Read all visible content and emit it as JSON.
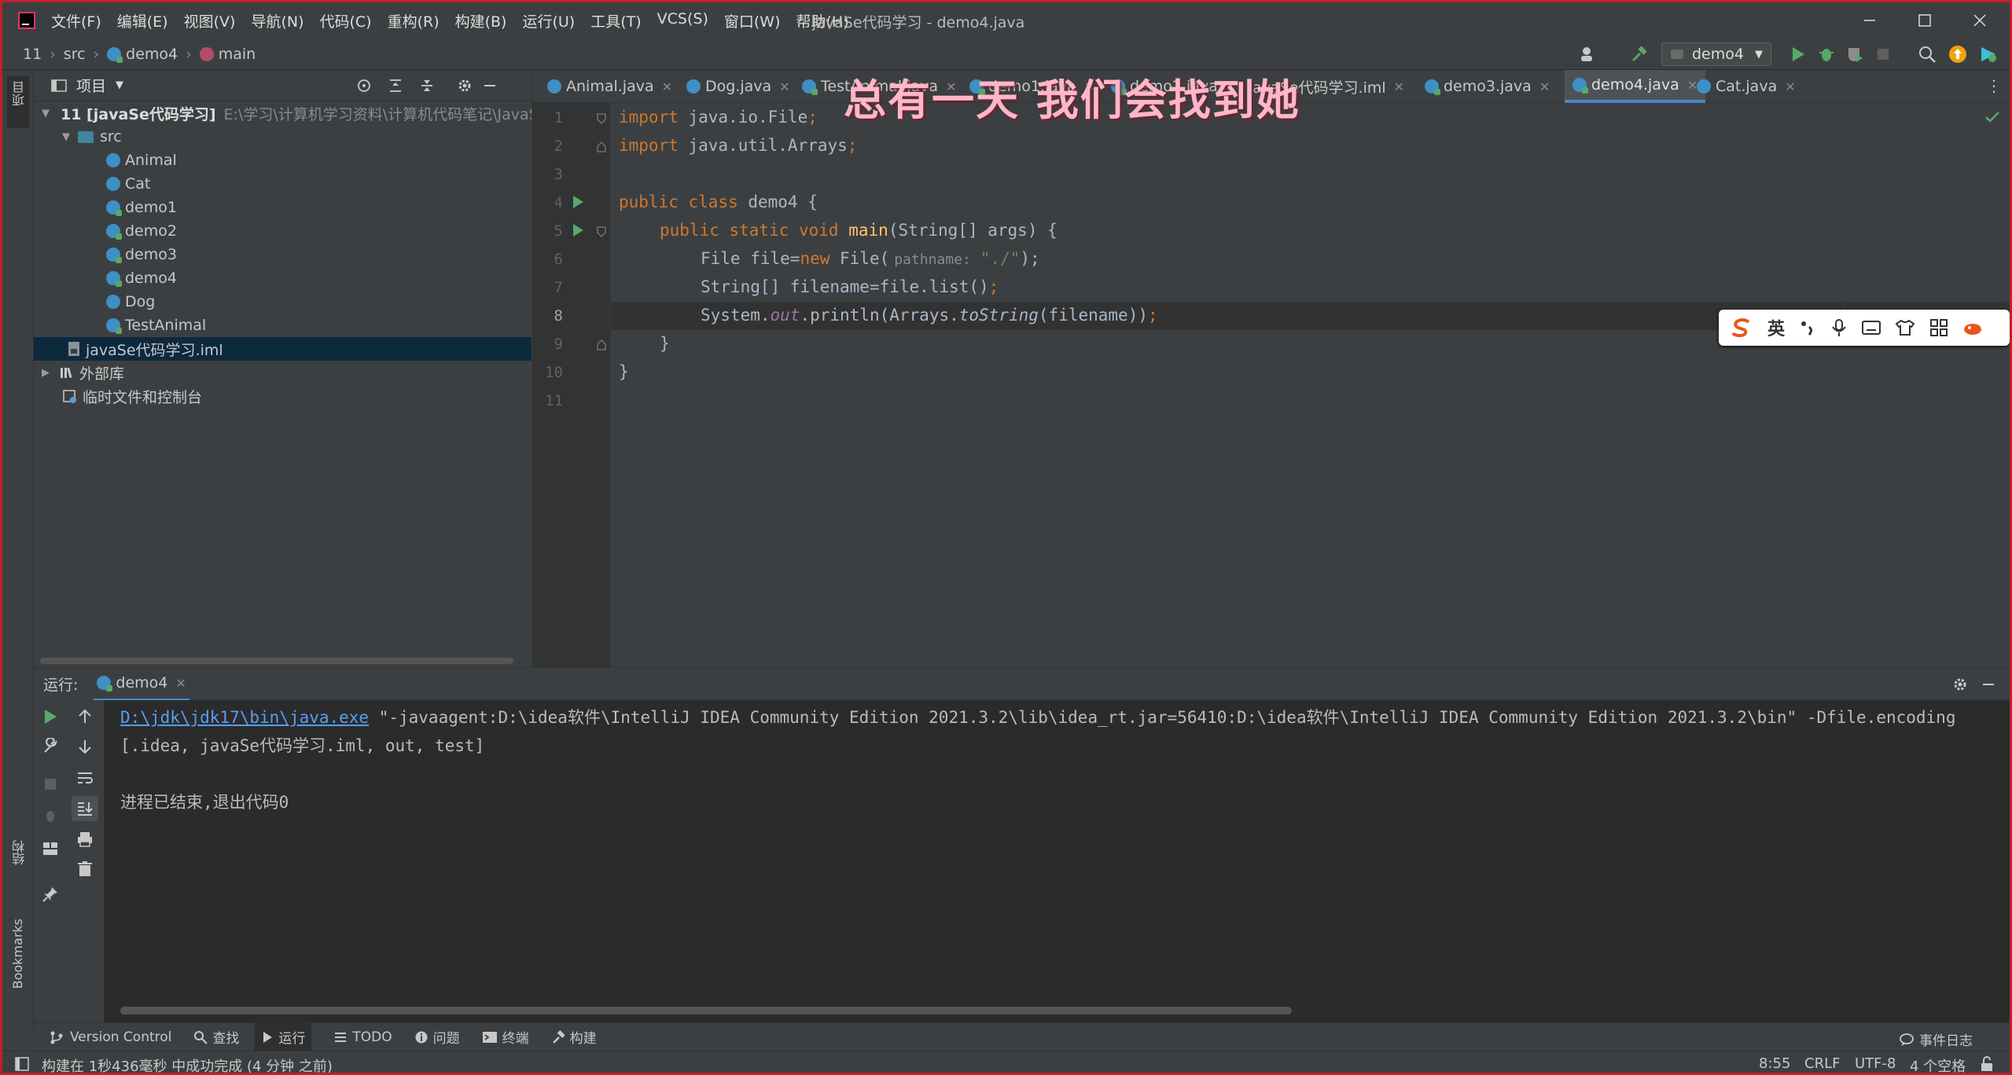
{
  "window": {
    "title": "javaSe代码学习 - demo4.java",
    "menus": [
      "文件(F)",
      "编辑(E)",
      "视图(V)",
      "导航(N)",
      "代码(C)",
      "重构(R)",
      "构建(B)",
      "运行(U)",
      "工具(T)",
      "VCS(S)",
      "窗口(W)",
      "帮助(H)"
    ]
  },
  "breadcrumb": [
    "11",
    "src",
    "demo4",
    "main"
  ],
  "run_config": "demo4",
  "project_panel": {
    "title": "项目",
    "root_label": "11 [javaSe代码学习]",
    "root_path": "E:\\学习\\计算机学习资料\\计算机代码笔记\\JavaSe\\",
    "src": "src",
    "classes": [
      "Animal",
      "Cat",
      "demo1",
      "demo2",
      "demo3",
      "demo4",
      "Dog",
      "TestAnimal"
    ],
    "iml": "javaSe代码学习.iml",
    "external_libs": "外部库",
    "scratches": "临时文件和控制台"
  },
  "left_strip": {
    "project": "项目",
    "structure": "结构",
    "bookmarks": "Bookmarks"
  },
  "tabs": [
    {
      "label": "Animal.java",
      "active": false
    },
    {
      "label": "Dog.java",
      "active": false
    },
    {
      "label": "TestAnimal.java",
      "active": false
    },
    {
      "label": "demo1.java",
      "active": false
    },
    {
      "label": "demo2.java",
      "active": false
    },
    {
      "label": "javaSe代码学习.iml",
      "active": false
    },
    {
      "label": "demo3.java",
      "active": false
    },
    {
      "label": "demo4.java",
      "active": true
    },
    {
      "label": "Cat.java",
      "active": false
    }
  ],
  "overlay_caption": "总有一天 我们会找到她",
  "editor": {
    "line_numbers": [
      "1",
      "2",
      "3",
      "4",
      "5",
      "6",
      "7",
      "8",
      "9",
      "10",
      "11"
    ],
    "current_line": 8,
    "code": {
      "l1_kw": "import",
      "l1_rest": " java.io.File",
      "l1_semi": ";",
      "l2_kw": "import",
      "l2_rest": " java.util.Arrays",
      "l2_semi": ";",
      "l4_kw": "public class",
      "l4_rest": " demo4 {",
      "l5_kw": "public static void",
      "l5_fn": "main",
      "l5_rest": "(String[] args) {",
      "l6_a": "File file=",
      "l6_kw": "new",
      "l6_b": " File(",
      "l6_hint": "pathname:",
      "l6_str": "\"./\"",
      "l6_c": ");",
      "l7_a": "String[] filename=file.list()",
      "l7_semi": ";",
      "l8_a": "System.",
      "l8_fld": "out",
      "l8_b": ".println(Arrays.",
      "l8_it": "toString",
      "l8_c": "(filename))",
      "l8_semi": ";",
      "l9": "}",
      "l10": "}"
    }
  },
  "ime_bar": {
    "lang": "英"
  },
  "run_panel": {
    "label": "运行:",
    "tab": "demo4",
    "cmd_link": "D:\\jdk\\jdk17\\bin\\java.exe",
    "cmd_rest": " \"-javaagent:D:\\idea软件\\IntelliJ IDEA Community Edition 2021.3.2\\lib\\idea_rt.jar=56410:D:\\idea软件\\IntelliJ IDEA Community Edition 2021.3.2\\bin\" -Dfile.encoding",
    "output": "[.idea, javaSe代码学习.iml, out, test]",
    "exit": "进程已结束,退出代码0"
  },
  "bottom_tools": [
    "Version Control",
    "查找",
    "运行",
    "TODO",
    "问题",
    "终端",
    "构建"
  ],
  "event_log": "事件日志",
  "status": {
    "message": "构建在 1秒436毫秒 中成功完成 (4 分钟 之前)",
    "position": "8:55",
    "line_sep": "CRLF",
    "encoding": "UTF-8",
    "indent": "4 个空格"
  },
  "colors": {
    "accent": "#4a88c7",
    "run_green": "#59a869",
    "frame_red": "#c0202a",
    "selection": "#0d293e"
  }
}
